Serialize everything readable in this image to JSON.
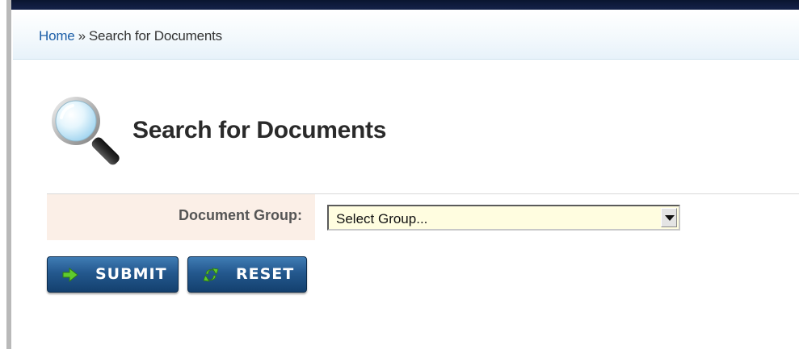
{
  "breadcrumb": {
    "home_label": "Home",
    "separator": "»",
    "current_label": "Search for Documents"
  },
  "page": {
    "title": "Search for Documents",
    "title_icon": "magnifier-icon"
  },
  "form": {
    "document_group": {
      "label": "Document Group:",
      "selected_value": "Select Group..."
    }
  },
  "buttons": {
    "submit": {
      "label": "SUBMIT",
      "icon": "arrow-right-icon"
    },
    "reset": {
      "label": "RESET",
      "icon": "refresh-icon"
    }
  },
  "colors": {
    "link": "#1d5fa8",
    "button_blue": "#24588e",
    "icon_green": "#58c52a",
    "label_background": "#fbefe7",
    "select_background": "#fffde0"
  }
}
